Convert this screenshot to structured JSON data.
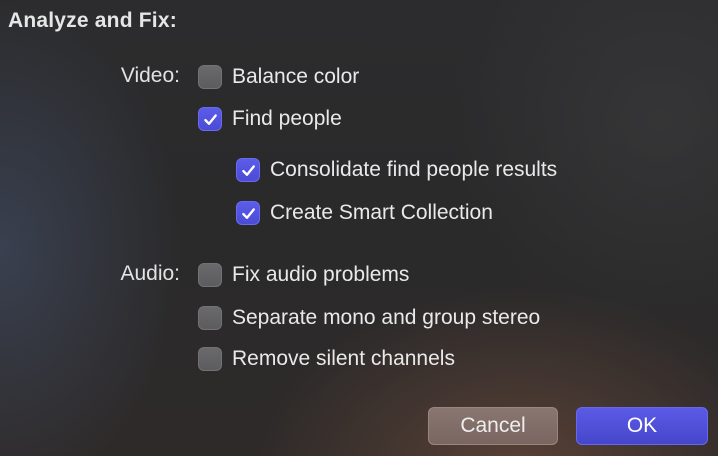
{
  "dialog": {
    "title": "Analyze and Fix:"
  },
  "video": {
    "label": "Video:",
    "options": [
      {
        "label": "Balance color",
        "checked": false
      },
      {
        "label": "Find people",
        "checked": true
      },
      {
        "label": "Consolidate find people results",
        "checked": true
      },
      {
        "label": "Create Smart Collection",
        "checked": true
      }
    ]
  },
  "audio": {
    "label": "Audio:",
    "options": [
      {
        "label": "Fix audio problems",
        "checked": false
      },
      {
        "label": "Separate mono and group stereo",
        "checked": false
      },
      {
        "label": "Remove silent channels",
        "checked": false
      }
    ]
  },
  "buttons": {
    "cancel": "Cancel",
    "ok": "OK"
  },
  "colors": {
    "accent": "#5252dc",
    "checkbox_off": "#636365",
    "cancel_button": "#826e69",
    "text": "#e8e8e8"
  },
  "icons": {
    "checkmark": "checkmark-icon"
  }
}
